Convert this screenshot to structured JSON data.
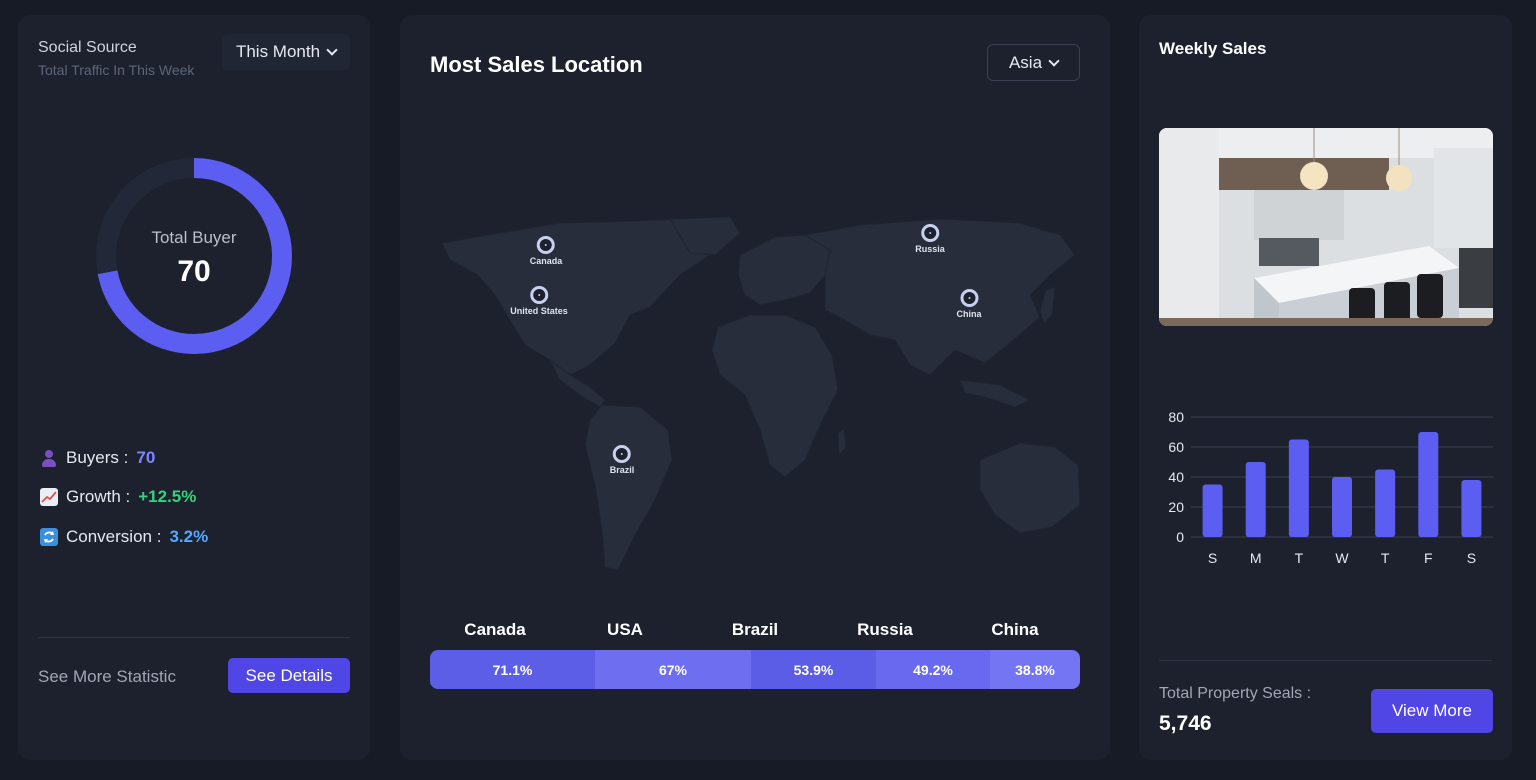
{
  "social": {
    "title": "Social Source",
    "subtitle": "Total Traffic In This Week",
    "period_dropdown": "This Month",
    "donut": {
      "label": "Total Buyer",
      "value": "70",
      "fraction": 0.72
    },
    "stats": [
      {
        "label": "Buyers :",
        "value": "70",
        "icon": "buyer-icon"
      },
      {
        "label": "Growth :",
        "value": "+12.5%",
        "icon": "chart-increasing-icon"
      },
      {
        "label": "Conversion :",
        "value": "3.2%",
        "icon": "refresh-icon"
      }
    ],
    "footer_text": "See More Statistic",
    "details_button": "See Details"
  },
  "map": {
    "title": "Most Sales Location",
    "region_dropdown": "Asia",
    "pins": [
      "Canada",
      "United States",
      "Russia",
      "China",
      "Brazil"
    ],
    "countries": [
      {
        "name": "Canada",
        "percent": "71.1%"
      },
      {
        "name": "USA",
        "percent": "67%"
      },
      {
        "name": "Brazil",
        "percent": "53.9%"
      },
      {
        "name": "Russia",
        "percent": "49.2%"
      },
      {
        "name": "China",
        "percent": "38.8%"
      }
    ]
  },
  "weekly": {
    "title": "Weekly Sales",
    "image": "kitchen-interior-photo",
    "total_label": "Total Property Seals :",
    "total_value": "5,746",
    "view_more_button": "View More"
  },
  "colors": {
    "accent": "#5b5ef0",
    "button": "#5046e5",
    "growth": "#35d27a",
    "conversion": "#55a7ff",
    "card": "#1c212d",
    "background": "#161b26"
  },
  "chart_data": {
    "type": "bar",
    "categories": [
      "S",
      "M",
      "T",
      "W",
      "T",
      "F",
      "S"
    ],
    "values": [
      35,
      50,
      65,
      40,
      45,
      70,
      38
    ],
    "ylim": [
      0,
      80
    ],
    "yticks": [
      0,
      20,
      40,
      60,
      80
    ],
    "grid": true
  }
}
